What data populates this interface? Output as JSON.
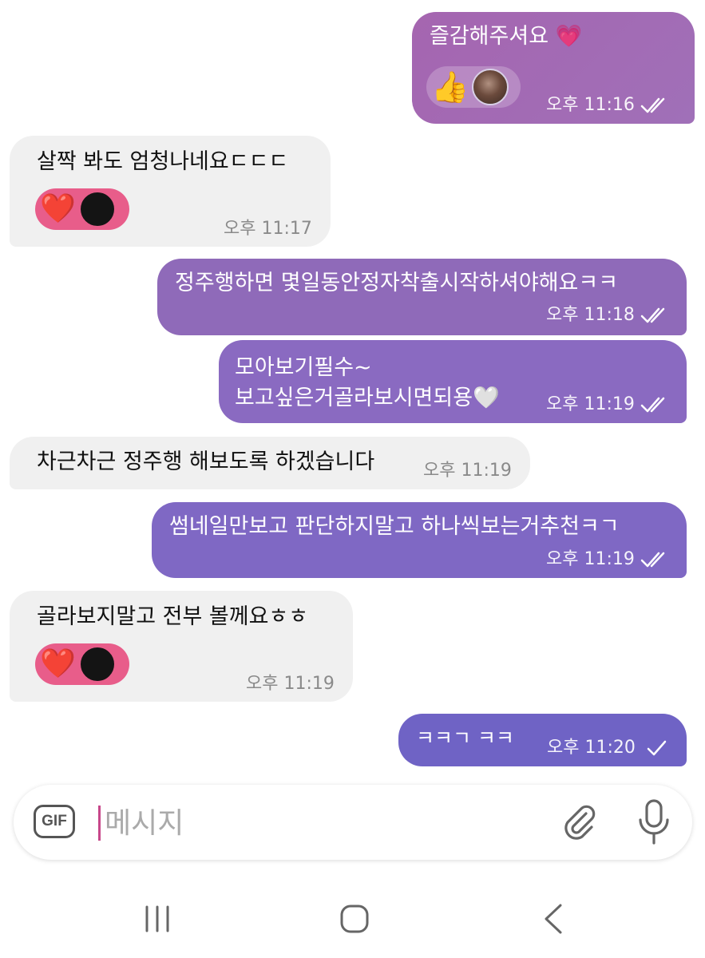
{
  "messages": [
    {
      "text": "즐감해주셔요 💗",
      "time": "오후 11:16"
    },
    {
      "text": "살짝 봐도 엄청나네요ㄷㄷㄷ",
      "time": "오후 11:17"
    },
    {
      "text": "정주행하면 몇일동안정자착출시작하셔야해요ㅋㅋ",
      "time": "오후 11:18"
    },
    {
      "line1": "모아보기필수~",
      "line2": "보고싶은거골라보시면되용🤍",
      "time": "오후 11:19"
    },
    {
      "text": "차근차근 정주행 해보도록 하겠습니다",
      "time": "오후 11:19"
    },
    {
      "text": "썸네일만보고 판단하지말고 하나씩보는거추천ㅋㄱ",
      "time": "오후 11:19"
    },
    {
      "text": "골라보지말고 전부 볼께요ㅎㅎ",
      "time": "오후 11:19"
    },
    {
      "text": "ㅋㅋㄱ ㅋㅋ",
      "time": "오후 11:20"
    }
  ],
  "reactions": {
    "thumbs_up": "👍",
    "heart": "❤️"
  },
  "input": {
    "placeholder": "메시지",
    "gif_label": "GIF"
  },
  "colors": {
    "bubble_out_1": "#a46ab2",
    "bubble_out_3": "#8f6ab9",
    "bubble_out_4": "#8a6ac1",
    "bubble_out_6": "#7f68c4",
    "bubble_out_8": "#6f63c5",
    "bubble_in": "#f0f0f0",
    "reaction_in": "#e85d8a",
    "cursor": "#c7478a"
  },
  "icons": [
    "double-check-icon",
    "single-check-icon",
    "gif-icon",
    "paperclip-icon",
    "microphone-icon",
    "recents-icon",
    "home-icon",
    "back-icon"
  ]
}
